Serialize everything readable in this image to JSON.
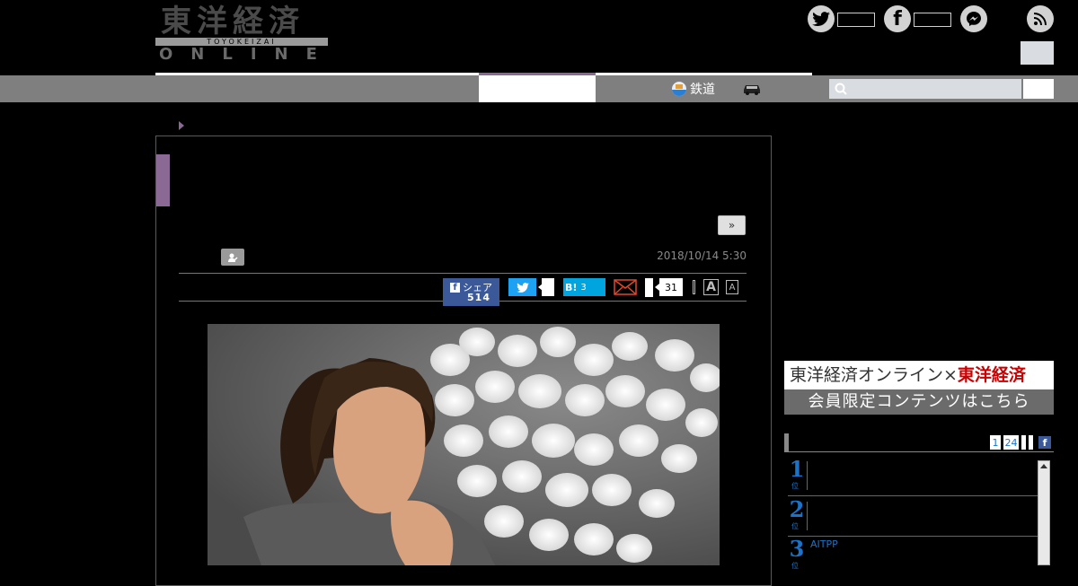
{
  "logo": {
    "kanji": "東洋経済",
    "romaji": "TOYOKEIZAI",
    "online": "ONLINE"
  },
  "nav": {
    "items": [
      {
        "label": "鉄道",
        "icon": "train-icon"
      },
      {
        "label": "",
        "icon": "car-icon"
      }
    ]
  },
  "article": {
    "next_label": "»",
    "date": "2018/10/14 5:30",
    "share": {
      "fb_label": "シェア",
      "fb_count": "514",
      "hatena_label": "B!",
      "hatena_count": "3",
      "comment_count": "31",
      "font_large": "A",
      "font_small": "A"
    }
  },
  "sidebar": {
    "banner_top_a": "東洋経済オンライン×",
    "banner_top_b": "東洋経済",
    "banner_bottom": "会員限定コンテンツはこちら",
    "ranking_tabs": [
      "1",
      "24"
    ],
    "ranking": [
      {
        "rank": "1",
        "text": ""
      },
      {
        "rank": "2",
        "text": ""
      },
      {
        "rank": "3",
        "text": "AITPP"
      }
    ]
  },
  "colors": {
    "accent_purple": "#8a6a94",
    "facebook": "#3b5998",
    "twitter": "#1da1f2",
    "hatena": "#00a4de",
    "link_blue": "#1a73c8"
  }
}
